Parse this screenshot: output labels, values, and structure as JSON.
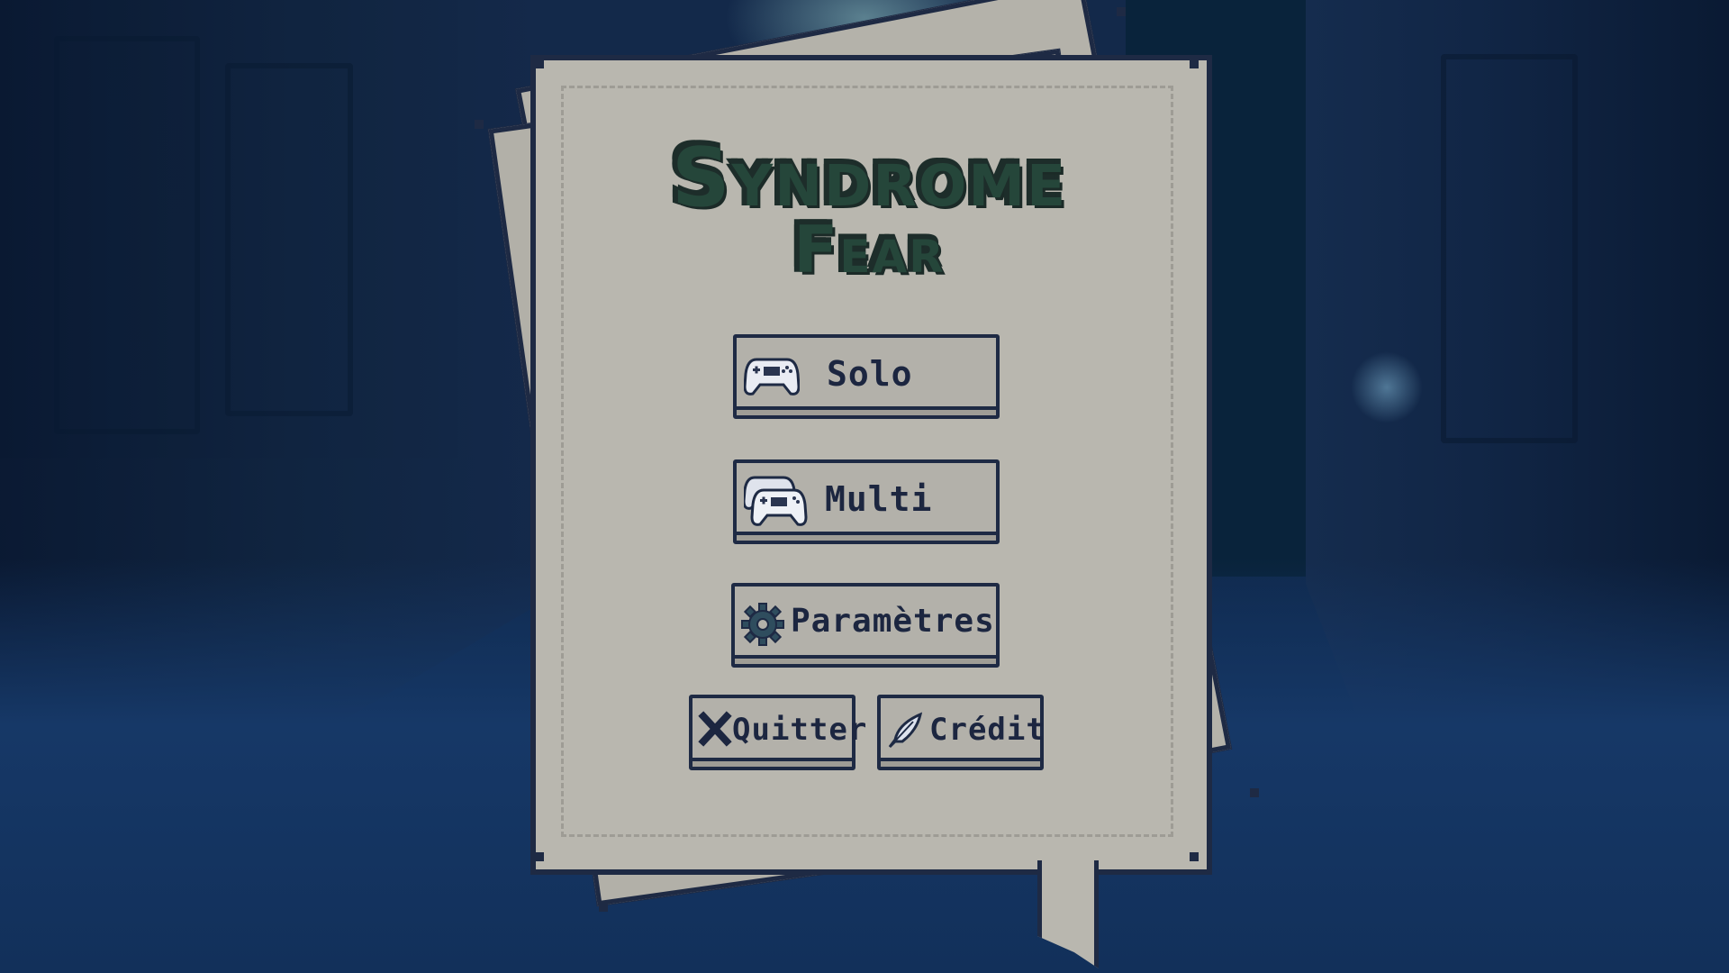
{
  "game": {
    "title_line1": "Syndrome",
    "title_line2": "Fear"
  },
  "menu": {
    "solo_label": "Solo",
    "multi_label": "Multi",
    "settings_label": "Paramètres",
    "quit_label": "Quitter",
    "credit_label": "Crédit"
  },
  "icons": {
    "solo": "gamepad-icon",
    "multi": "two-gamepads-icon",
    "settings": "gear-icon",
    "quit": "close-icon",
    "credit": "feather-icon"
  },
  "colors": {
    "paper": "#b9b7af",
    "outline": "#1e2a44",
    "title_green": "#5f9077",
    "background": "#13294a"
  }
}
